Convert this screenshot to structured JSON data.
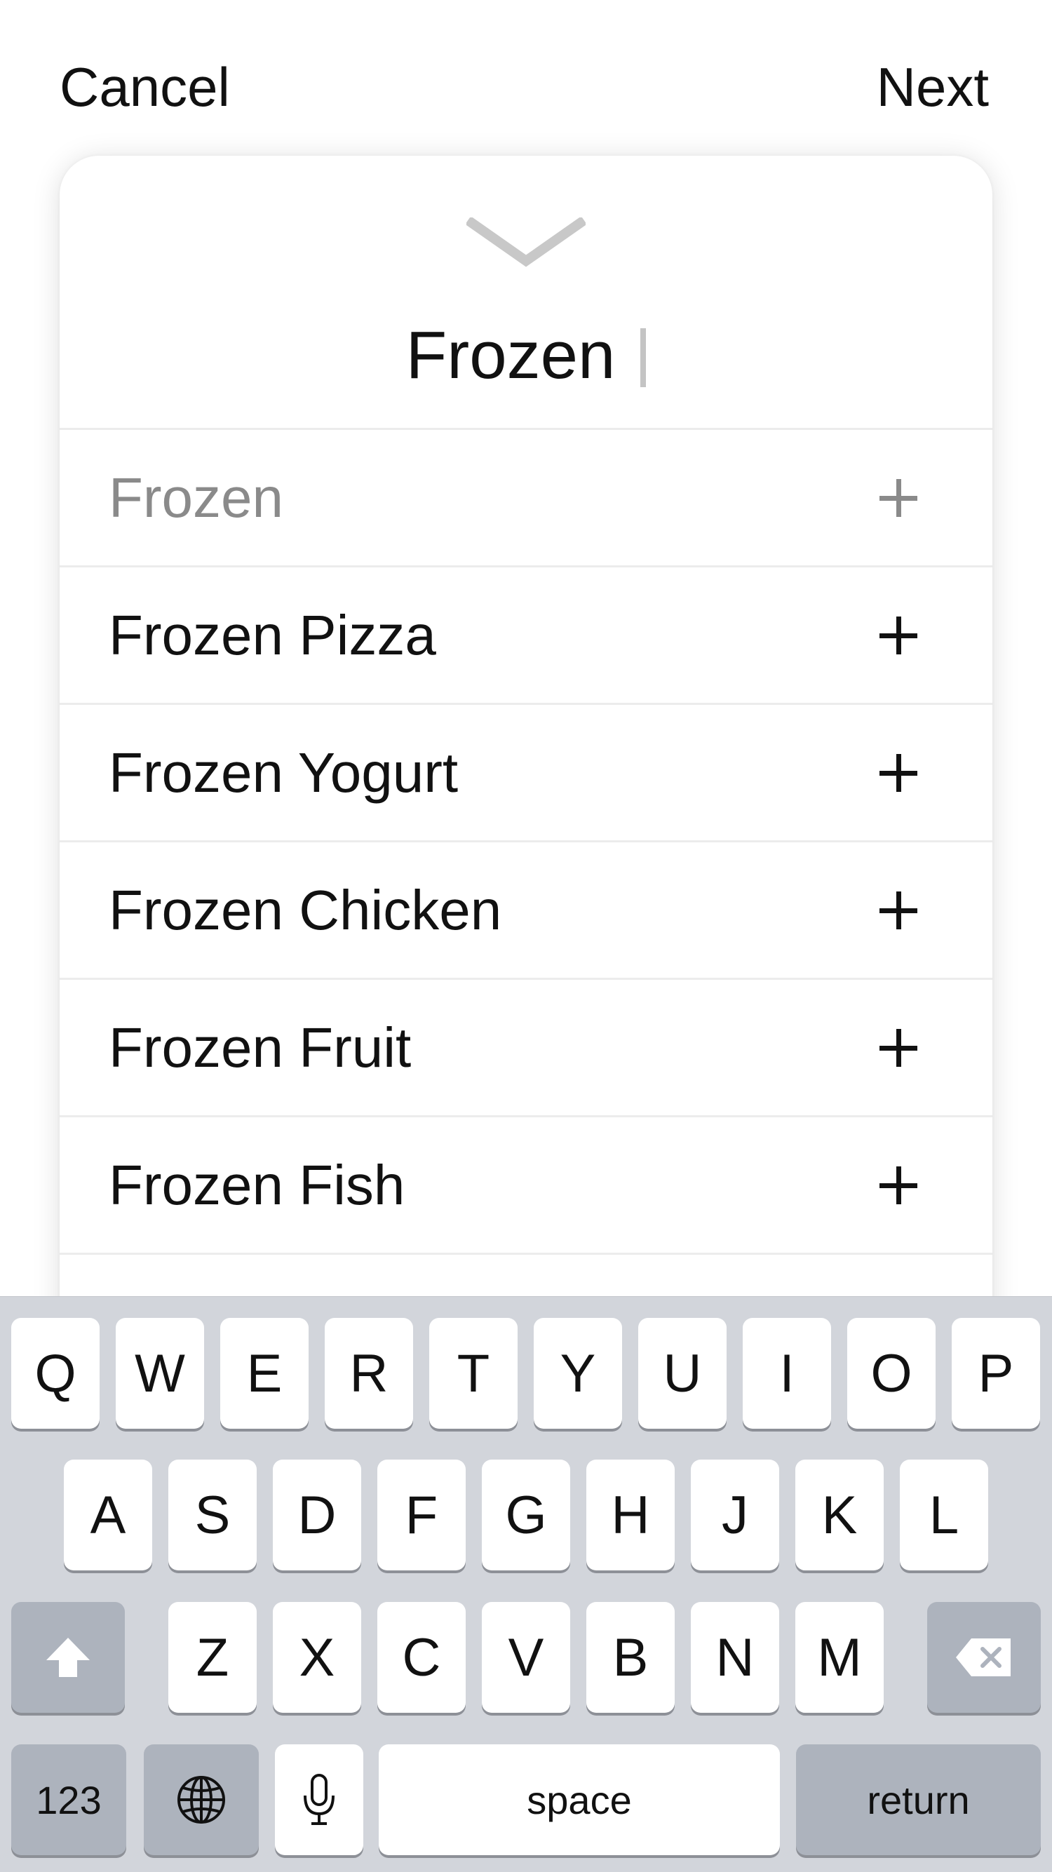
{
  "topbar": {
    "cancel_label": "Cancel",
    "next_label": "Next"
  },
  "card": {
    "handle_icon": "chevron-down-icon",
    "search_value": "Frozen",
    "results": [
      {
        "label": "Frozen",
        "icon": "plus-icon",
        "muted": true
      },
      {
        "label": "Frozen Pizza",
        "icon": "plus-icon",
        "muted": false
      },
      {
        "label": "Frozen Yogurt",
        "icon": "plus-icon",
        "muted": false
      },
      {
        "label": "Frozen Chicken",
        "icon": "plus-icon",
        "muted": false
      },
      {
        "label": "Frozen Fruit",
        "icon": "plus-icon",
        "muted": false
      },
      {
        "label": "Frozen Fish",
        "icon": "plus-icon",
        "muted": false
      }
    ]
  },
  "keyboard": {
    "row1": [
      "Q",
      "W",
      "E",
      "R",
      "T",
      "Y",
      "U",
      "I",
      "O",
      "P"
    ],
    "row2": [
      "A",
      "S",
      "D",
      "F",
      "G",
      "H",
      "J",
      "K",
      "L"
    ],
    "row3": [
      "Z",
      "X",
      "C",
      "V",
      "B",
      "N",
      "M"
    ],
    "shift_icon": "shift-arrow-icon",
    "delete_icon": "backspace-icon",
    "numbers_label": "123",
    "globe_icon": "globe-icon",
    "mic_icon": "microphone-icon",
    "space_label": "space",
    "return_label": "return"
  },
  "colors": {
    "keyboard_bg": "#d2d5db",
    "key_bg": "#ffffff",
    "special_key_bg": "#adb3bd",
    "muted_text": "#8a8a8a"
  }
}
